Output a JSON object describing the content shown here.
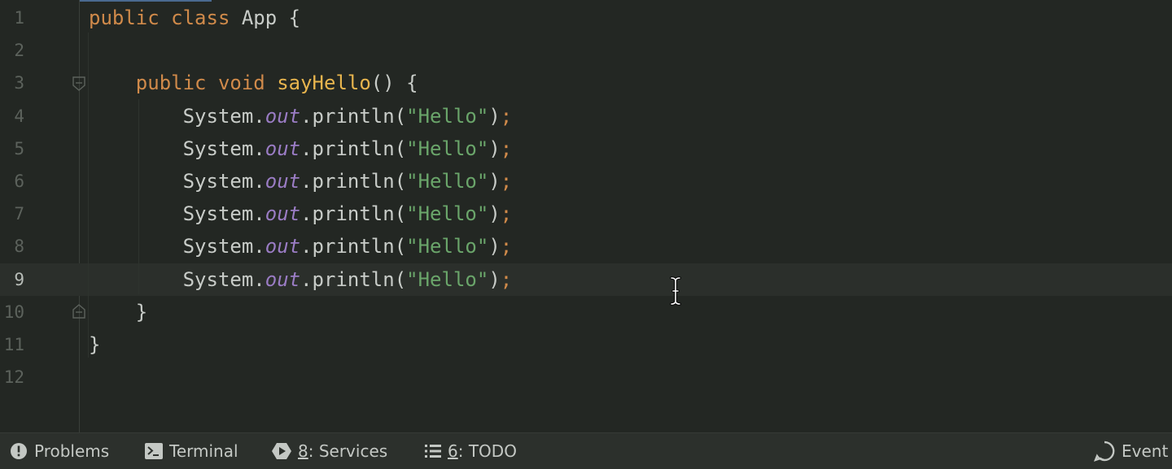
{
  "editor": {
    "lines": [
      {
        "num": "1",
        "tokens": [
          {
            "t": "public",
            "c": "kw"
          },
          {
            "t": " "
          },
          {
            "t": "class",
            "c": "kw"
          },
          {
            "t": " App {"
          }
        ]
      },
      {
        "num": "2",
        "tokens": []
      },
      {
        "num": "3",
        "tokens": [
          {
            "t": "    "
          },
          {
            "t": "public",
            "c": "kw"
          },
          {
            "t": " "
          },
          {
            "t": "void",
            "c": "kw"
          },
          {
            "t": " "
          },
          {
            "t": "sayHello",
            "c": "fn"
          },
          {
            "t": "() {"
          }
        ]
      },
      {
        "num": "4",
        "tokens": [
          {
            "t": "        System."
          },
          {
            "t": "out",
            "c": "fld"
          },
          {
            "t": ".println("
          },
          {
            "t": "\"Hello\"",
            "c": "str"
          },
          {
            "t": ")"
          },
          {
            "t": ";",
            "c": "semi"
          }
        ]
      },
      {
        "num": "5",
        "tokens": [
          {
            "t": "        System."
          },
          {
            "t": "out",
            "c": "fld"
          },
          {
            "t": ".println("
          },
          {
            "t": "\"Hello\"",
            "c": "str"
          },
          {
            "t": ")"
          },
          {
            "t": ";",
            "c": "semi"
          }
        ]
      },
      {
        "num": "6",
        "tokens": [
          {
            "t": "        System."
          },
          {
            "t": "out",
            "c": "fld"
          },
          {
            "t": ".println("
          },
          {
            "t": "\"Hello\"",
            "c": "str"
          },
          {
            "t": ")"
          },
          {
            "t": ";",
            "c": "semi"
          }
        ]
      },
      {
        "num": "7",
        "tokens": [
          {
            "t": "        System."
          },
          {
            "t": "out",
            "c": "fld"
          },
          {
            "t": ".println("
          },
          {
            "t": "\"Hello\"",
            "c": "str"
          },
          {
            "t": ")"
          },
          {
            "t": ";",
            "c": "semi"
          }
        ]
      },
      {
        "num": "8",
        "tokens": [
          {
            "t": "        System."
          },
          {
            "t": "out",
            "c": "fld"
          },
          {
            "t": ".println("
          },
          {
            "t": "\"Hello\"",
            "c": "str"
          },
          {
            "t": ")"
          },
          {
            "t": ";",
            "c": "semi"
          }
        ]
      },
      {
        "num": "9",
        "tokens": [
          {
            "t": "        System."
          },
          {
            "t": "out",
            "c": "fld"
          },
          {
            "t": ".println("
          },
          {
            "t": "\"Hello\"",
            "c": "str"
          },
          {
            "t": ")"
          },
          {
            "t": ";",
            "c": "semi"
          }
        ]
      },
      {
        "num": "10",
        "tokens": [
          {
            "t": "    }"
          }
        ]
      },
      {
        "num": "11",
        "tokens": [
          {
            "t": "}"
          }
        ]
      },
      {
        "num": "12",
        "tokens": []
      }
    ],
    "current_line": "9"
  },
  "statusbar": {
    "problems_label": "Problems",
    "terminal_label": "Terminal",
    "services_key": "8",
    "services_label": ": Services",
    "todo_key": "6",
    "todo_label": ": TODO",
    "event_label": "Event"
  },
  "colors": {
    "keyword": "#d08a4a",
    "method": "#e8b54e",
    "field": "#9a7cc4",
    "string": "#6aa56a",
    "background": "#232723"
  }
}
